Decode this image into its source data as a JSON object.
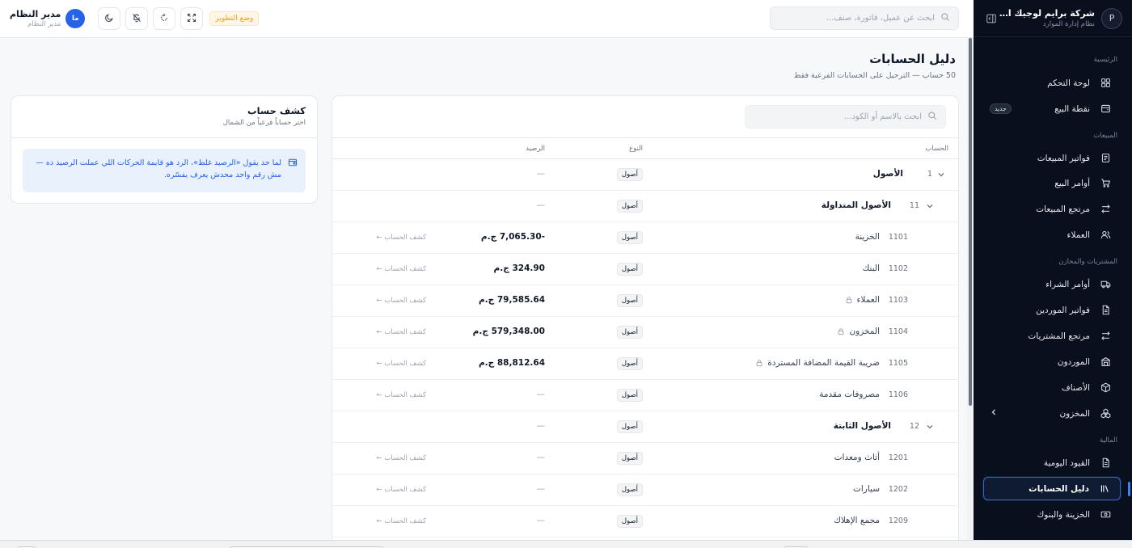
{
  "sidebar": {
    "brand_logo": "P",
    "brand_title": "شركة برايم لوجيك التجر...",
    "brand_subtitle": "نظام إدارة الموارد",
    "sections": {
      "home": "الرئيسية",
      "sales": "المبيعات",
      "purchases": "المشتريات والمخازن",
      "finance": "المالية"
    },
    "items": {
      "dashboard": "لوحة التحكم",
      "pos": "نقطة البيع",
      "pos_badge": "جديد",
      "sales_invoices": "فواتير المبيعات",
      "sales_orders": "أوامر البيع",
      "sales_returns": "مرتجع المبيعات",
      "customers": "العملاء",
      "purchase_orders": "أوامر الشراء",
      "supplier_invoices": "فواتير الموردين",
      "purchase_returns": "مرتجع المشتريات",
      "suppliers": "الموردون",
      "items_catalog": "الأصناف",
      "inventory": "المخزون",
      "journal": "القيود اليومية",
      "chart_of_accounts": "دليل الحسابات",
      "treasury": "الخزينة والبنوك"
    }
  },
  "topbar": {
    "search_placeholder": "ابحث عن عميل، فاتورة، صنف...",
    "user_name": "مدير النظام",
    "user_role": "مدير النظام",
    "avatar_initials": "ما",
    "dev_mode_label": "وضع التطوير"
  },
  "page": {
    "title": "دليل الحسابات",
    "subtitle": "50 حساب — الترحيل على الحسابات الفرعية فقط"
  },
  "accounts": {
    "search_placeholder": "ابحث بالاسم أو الكود...",
    "columns": {
      "account": "الحساب",
      "type": "النوع",
      "balance": "الرصيد"
    },
    "rows": [
      {
        "code": "1",
        "name": "الأصول",
        "type": "أصول",
        "balance": "—",
        "group": true
      },
      {
        "code": "11",
        "name": "الأصول المتداولة",
        "type": "أصول",
        "balance": "—",
        "group": true
      },
      {
        "code": "1101",
        "name": "الخزينة",
        "type": "أصول",
        "balance": "-7,065.30 ج.م",
        "link": "كشف الحساب ←"
      },
      {
        "code": "1102",
        "name": "البنك",
        "type": "أصول",
        "balance": "324.90 ج.م",
        "link": "كشف الحساب ←"
      },
      {
        "code": "1103",
        "name": "العملاء",
        "type": "أصول",
        "balance": "79,585.64 ج.م",
        "link": "كشف الحساب ←"
      },
      {
        "code": "1104",
        "name": "المخزون",
        "type": "أصول",
        "balance": "579,348.00 ج.م",
        "link": "كشف الحساب ←"
      },
      {
        "code": "1105",
        "name": "ضريبة القيمة المضافة المستردة",
        "type": "أصول",
        "balance": "88,812.64 ج.م",
        "link": "كشف الحساب ←"
      },
      {
        "code": "1106",
        "name": "مصروفات مقدمة",
        "type": "أصول",
        "balance": "—",
        "link": "كشف الحساب ←"
      },
      {
        "code": "12",
        "name": "الأصول الثابتة",
        "type": "أصول",
        "balance": "—",
        "group": true
      },
      {
        "code": "1201",
        "name": "أثاث ومعدات",
        "type": "أصول",
        "balance": "—",
        "link": "كشف الحساب ←"
      },
      {
        "code": "1202",
        "name": "سيارات",
        "type": "أصول",
        "balance": "—",
        "link": "كشف الحساب ←"
      },
      {
        "code": "1209",
        "name": "مجمع الإهلاك",
        "type": "أصول",
        "balance": "—",
        "link": "كشف الحساب ←"
      }
    ]
  },
  "statement": {
    "title": "كشف حساب",
    "subtitle": "اختر حساباً فرعياً من الشمال",
    "info": "لما حد يقول «الرصيد غلط»، الرد هو قايمة الحركات اللي عملت الرصيد ده — مش رقم واحد محدش يعرف يفسّره."
  }
}
